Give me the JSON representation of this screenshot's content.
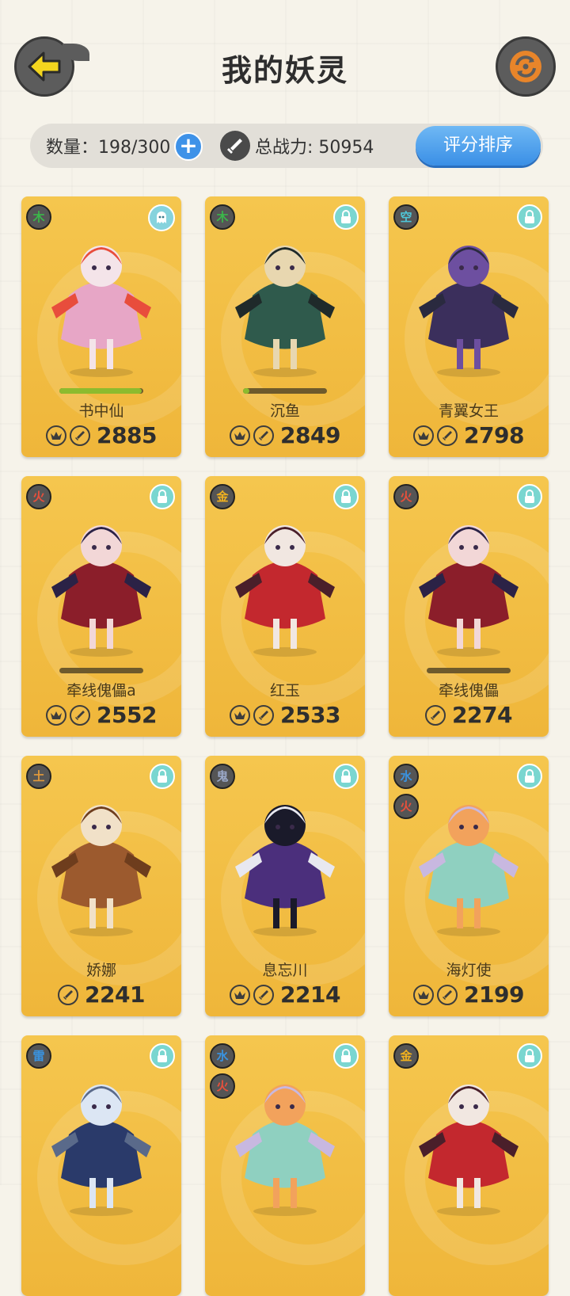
{
  "header": {
    "title": "我的妖灵"
  },
  "stats": {
    "count_label": "数量",
    "count_value": "198/300",
    "power_label": "总战力",
    "power_value": "50954",
    "sort_label": "评分排序"
  },
  "cards": [
    {
      "name": "书中仙",
      "elements": [
        "木"
      ],
      "element_colors": [
        "#3bb64a"
      ],
      "corner": "ghost",
      "crown": true,
      "progress": 0.98,
      "score": "2885",
      "figure_colors": [
        "#e7a6c6",
        "#f4e4e9",
        "#e84d3c"
      ]
    },
    {
      "name": "沉鱼",
      "elements": [
        "木"
      ],
      "element_colors": [
        "#3bb64a"
      ],
      "corner": "lock",
      "crown": true,
      "progress": 0.08,
      "score": "2849",
      "figure_colors": [
        "#2f5a4c",
        "#e8d7b0",
        "#1f2a2a"
      ]
    },
    {
      "name": "青翼女王",
      "elements": [
        "空"
      ],
      "element_colors": [
        "#4fc6d8"
      ],
      "corner": "lock",
      "crown": true,
      "progress": null,
      "score": "2798",
      "figure_colors": [
        "#3b2f5c",
        "#6d4fa0",
        "#2a2a3f"
      ]
    },
    {
      "name": "牵线傀儡a",
      "elements": [
        "火"
      ],
      "element_colors": [
        "#e8503c"
      ],
      "corner": "lock",
      "crown": true,
      "progress": 0.0,
      "score": "2552",
      "figure_colors": [
        "#8b1e2a",
        "#f2d7d7",
        "#2b2246"
      ]
    },
    {
      "name": "红玉",
      "elements": [
        "金"
      ],
      "element_colors": [
        "#f2b21e"
      ],
      "corner": "lock",
      "crown": true,
      "progress": null,
      "score": "2533",
      "figure_colors": [
        "#c3282e",
        "#f1e7e1",
        "#4a1f2a"
      ]
    },
    {
      "name": "牵线傀儡",
      "elements": [
        "火"
      ],
      "element_colors": [
        "#e8503c"
      ],
      "corner": "lock",
      "crown": false,
      "progress": 0.0,
      "score": "2274",
      "figure_colors": [
        "#8b1e2a",
        "#f2d7d7",
        "#2b2246"
      ]
    },
    {
      "name": "娇娜",
      "elements": [
        "土"
      ],
      "element_colors": [
        "#e39a3a"
      ],
      "corner": "lock",
      "crown": false,
      "progress": null,
      "score": "2241",
      "figure_colors": [
        "#9c5a2e",
        "#f1e1c8",
        "#6e3d1d"
      ]
    },
    {
      "name": "息忘川",
      "elements": [
        "鬼"
      ],
      "element_colors": [
        "#9aa8c8"
      ],
      "corner": "lock",
      "crown": true,
      "progress": null,
      "score": "2214",
      "figure_colors": [
        "#4b2f7c",
        "#1a1a2a",
        "#e8e8f0"
      ]
    },
    {
      "name": "海灯使",
      "elements": [
        "水",
        "火"
      ],
      "element_colors": [
        "#3a93e0",
        "#e8503c"
      ],
      "corner": "lock",
      "crown": true,
      "progress": null,
      "score": "2199",
      "figure_colors": [
        "#8fd0c0",
        "#f2a25c",
        "#c8b8e0"
      ]
    },
    {
      "name": "",
      "elements": [
        "雷"
      ],
      "element_colors": [
        "#3a93e0"
      ],
      "corner": "lock",
      "crown": false,
      "progress": null,
      "score": "",
      "figure_colors": [
        "#2a3a6a",
        "#dce6f4",
        "#5a6a8a"
      ]
    },
    {
      "name": "",
      "elements": [
        "水",
        "火"
      ],
      "element_colors": [
        "#3a93e0",
        "#e8503c"
      ],
      "corner": "lock",
      "crown": false,
      "progress": null,
      "score": "",
      "figure_colors": [
        "#8fd0c0",
        "#f2a25c",
        "#c8b8e0"
      ]
    },
    {
      "name": "",
      "elements": [
        "金"
      ],
      "element_colors": [
        "#f2b21e"
      ],
      "corner": "lock",
      "crown": false,
      "progress": null,
      "score": "",
      "figure_colors": [
        "#c3282e",
        "#f1e7e1",
        "#4a1f2a"
      ]
    }
  ]
}
